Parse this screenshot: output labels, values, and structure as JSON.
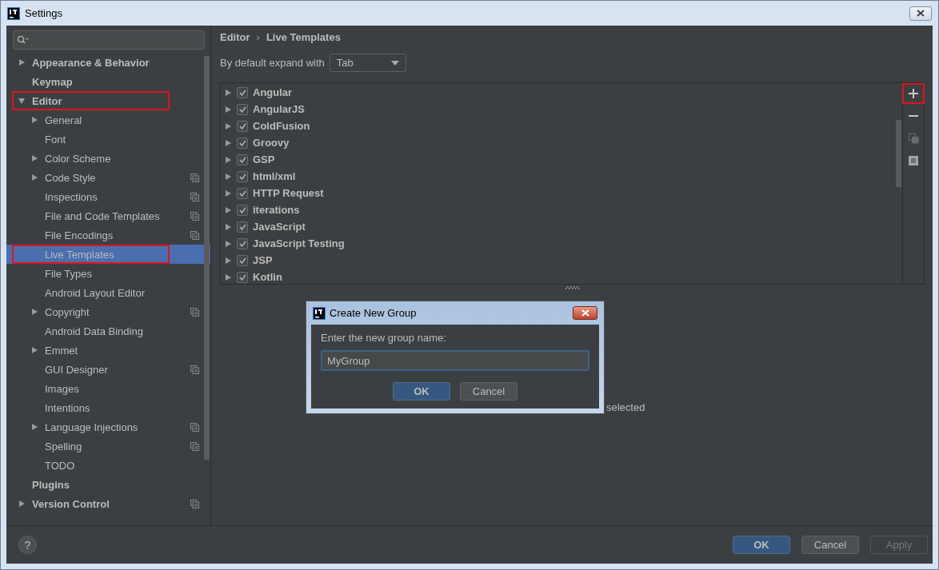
{
  "window": {
    "title": "Settings"
  },
  "sidebar": {
    "items": [
      {
        "label": "Appearance & Behavior",
        "kind": "group",
        "expanded": false,
        "selected": false,
        "marked": false,
        "copy_icon": false
      },
      {
        "label": "Keymap",
        "kind": "page",
        "selected": false,
        "marked": false,
        "copy_icon": false
      },
      {
        "label": "Editor",
        "kind": "group",
        "expanded": true,
        "selected": false,
        "marked": true,
        "copy_icon": false,
        "children": [
          {
            "label": "General",
            "kind": "group",
            "expanded": false,
            "selected": false,
            "marked": false,
            "copy_icon": false
          },
          {
            "label": "Font",
            "kind": "page",
            "selected": false,
            "marked": false,
            "copy_icon": false
          },
          {
            "label": "Color Scheme",
            "kind": "group",
            "expanded": false,
            "selected": false,
            "marked": false,
            "copy_icon": false
          },
          {
            "label": "Code Style",
            "kind": "group",
            "expanded": false,
            "selected": false,
            "marked": false,
            "copy_icon": true
          },
          {
            "label": "Inspections",
            "kind": "page",
            "selected": false,
            "marked": false,
            "copy_icon": true
          },
          {
            "label": "File and Code Templates",
            "kind": "page",
            "selected": false,
            "marked": false,
            "copy_icon": true
          },
          {
            "label": "File Encodings",
            "kind": "page",
            "selected": false,
            "marked": false,
            "copy_icon": true
          },
          {
            "label": "Live Templates",
            "kind": "page",
            "selected": true,
            "marked": true,
            "copy_icon": false
          },
          {
            "label": "File Types",
            "kind": "page",
            "selected": false,
            "marked": false,
            "copy_icon": false
          },
          {
            "label": "Android Layout Editor",
            "kind": "page",
            "selected": false,
            "marked": false,
            "copy_icon": false
          },
          {
            "label": "Copyright",
            "kind": "group",
            "expanded": false,
            "selected": false,
            "marked": false,
            "copy_icon": true
          },
          {
            "label": "Android Data Binding",
            "kind": "page",
            "selected": false,
            "marked": false,
            "copy_icon": false
          },
          {
            "label": "Emmet",
            "kind": "group",
            "expanded": false,
            "selected": false,
            "marked": false,
            "copy_icon": false
          },
          {
            "label": "GUI Designer",
            "kind": "page",
            "selected": false,
            "marked": false,
            "copy_icon": true
          },
          {
            "label": "Images",
            "kind": "page",
            "selected": false,
            "marked": false,
            "copy_icon": false
          },
          {
            "label": "Intentions",
            "kind": "page",
            "selected": false,
            "marked": false,
            "copy_icon": false
          },
          {
            "label": "Language Injections",
            "kind": "group",
            "expanded": false,
            "selected": false,
            "marked": false,
            "copy_icon": true
          },
          {
            "label": "Spelling",
            "kind": "page",
            "selected": false,
            "marked": false,
            "copy_icon": true
          },
          {
            "label": "TODO",
            "kind": "page",
            "selected": false,
            "marked": false,
            "copy_icon": false
          }
        ]
      },
      {
        "label": "Plugins",
        "kind": "page",
        "selected": false,
        "marked": false,
        "copy_icon": false
      },
      {
        "label": "Version Control",
        "kind": "group",
        "expanded": false,
        "selected": false,
        "marked": false,
        "copy_icon": true
      }
    ]
  },
  "breadcrumb": {
    "parent": "Editor",
    "separator": "›",
    "current": "Live Templates"
  },
  "expand_with": {
    "label": "By default expand with",
    "value": "Tab"
  },
  "templates": [
    {
      "name": "Angular",
      "checked": true,
      "expanded": false
    },
    {
      "name": "AngularJS",
      "checked": true,
      "expanded": false
    },
    {
      "name": "ColdFusion",
      "checked": true,
      "expanded": false
    },
    {
      "name": "Groovy",
      "checked": true,
      "expanded": false
    },
    {
      "name": "GSP",
      "checked": true,
      "expanded": false
    },
    {
      "name": "html/xml",
      "checked": true,
      "expanded": false
    },
    {
      "name": "HTTP Request",
      "checked": true,
      "expanded": false
    },
    {
      "name": "iterations",
      "checked": true,
      "expanded": false
    },
    {
      "name": "JavaScript",
      "checked": true,
      "expanded": false
    },
    {
      "name": "JavaScript Testing",
      "checked": true,
      "expanded": false
    },
    {
      "name": "JSP",
      "checked": true,
      "expanded": false
    },
    {
      "name": "Kotlin",
      "checked": true,
      "expanded": false
    }
  ],
  "toolbar": [
    {
      "kind": "add",
      "disabled": false,
      "marked": true
    },
    {
      "kind": "remove",
      "disabled": false,
      "marked": false
    },
    {
      "kind": "copy",
      "disabled": true,
      "marked": false
    },
    {
      "kind": "list",
      "disabled": false,
      "marked": false
    }
  ],
  "status_text": "selected",
  "dialog": {
    "title": "Create New Group",
    "label": "Enter the new group name:",
    "value": "MyGroup",
    "buttons": [
      {
        "label": "OK",
        "default": true
      },
      {
        "label": "Cancel",
        "default": false
      }
    ]
  },
  "help": "?",
  "footer_buttons": [
    {
      "label": "OK",
      "default": true,
      "disabled": false
    },
    {
      "label": "Cancel",
      "default": false,
      "disabled": false
    },
    {
      "label": "Apply",
      "default": false,
      "disabled": true
    }
  ]
}
